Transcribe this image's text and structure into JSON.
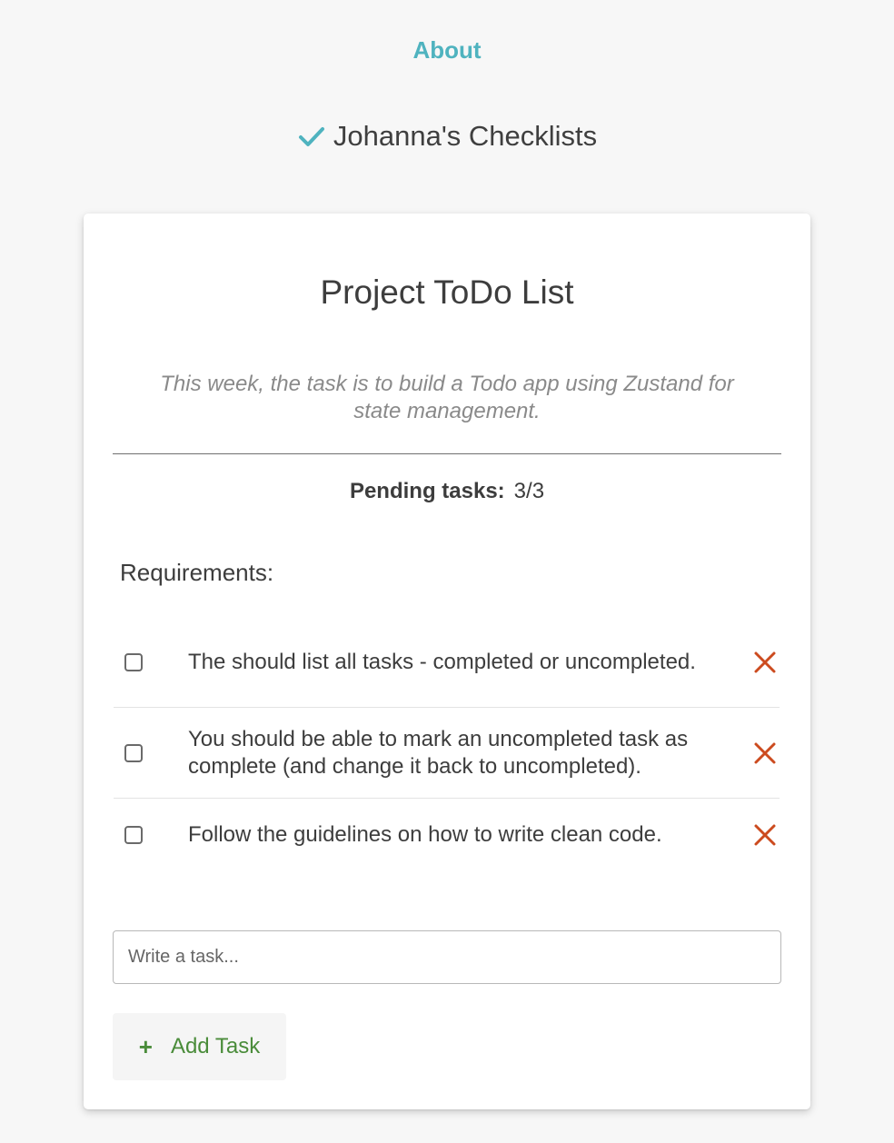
{
  "nav": {
    "about_label": "About"
  },
  "header": {
    "title": "Johanna's Checklists",
    "icon": "check-icon"
  },
  "card": {
    "title": "Project ToDo List",
    "description": "This week, the task is to build a Todo app using Zustand for state management.",
    "pending": {
      "label": "Pending tasks:",
      "value": "3/3"
    },
    "section_title": "Requirements:",
    "tasks": [
      {
        "text": "The should list all tasks - completed or uncompleted.",
        "completed": false
      },
      {
        "text": "You should be able to mark an uncompleted task as complete (and change it back to uncompleted).",
        "completed": false
      },
      {
        "text": "Follow the guidelines on how to write clean code.",
        "completed": false
      }
    ],
    "input": {
      "placeholder": "Write a task...",
      "value": ""
    },
    "add_button": {
      "icon": "+",
      "label": "Add Task"
    }
  },
  "colors": {
    "background": "#f7f7f7",
    "accent": "#4fb3bf",
    "delete": "#cc4b1f",
    "add": "#4a8c3a",
    "card": "#ffffff"
  }
}
